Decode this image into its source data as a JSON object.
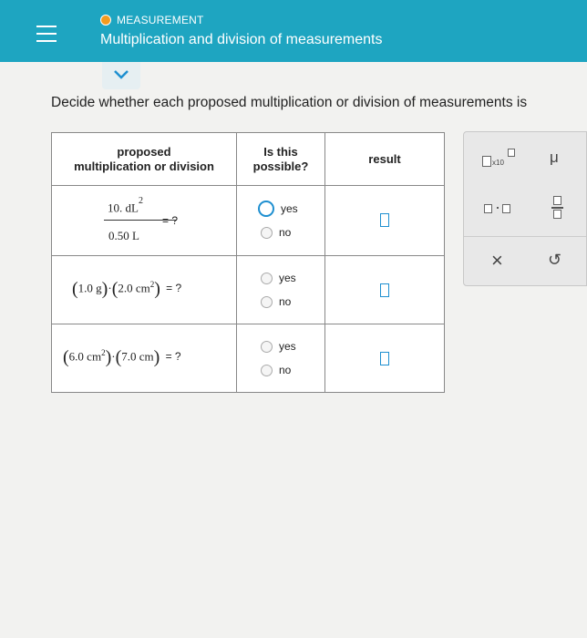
{
  "header": {
    "topic": "MEASUREMENT",
    "title": "Multiplication and division of measurements"
  },
  "question": "Decide whether each proposed multiplication or division of measurements is",
  "table": {
    "headers": {
      "col1_line1": "proposed",
      "col1_line2": "multiplication or division",
      "col2_line1": "Is this",
      "col2_line2": "possible?",
      "col3": "result"
    },
    "rows": [
      {
        "numerator": "10. dL",
        "exp": "2",
        "denominator": "0.50 L",
        "equals": "= ?",
        "yes": "yes",
        "no": "no"
      },
      {
        "f1_num": "1.0",
        "f1_unit": "g",
        "dot": "·",
        "f2_num": "2.0",
        "f2_unit": "cm",
        "f2_exp": "2",
        "equals": "= ?",
        "yes": "yes",
        "no": "no"
      },
      {
        "f1_num": "6.0",
        "f1_unit": "cm",
        "f1_exp": "2",
        "dot": "·",
        "f2_num": "7.0",
        "f2_unit": "cm",
        "equals": "= ?",
        "yes": "yes",
        "no": "no"
      }
    ]
  },
  "palette": {
    "x10_label": "x10",
    "mu": "μ",
    "dot": "·",
    "clear": "×",
    "undo": "↺"
  },
  "colors": {
    "header": "#1ea5c1",
    "accent": "#1e8fd0",
    "status": "#f39b1f"
  }
}
